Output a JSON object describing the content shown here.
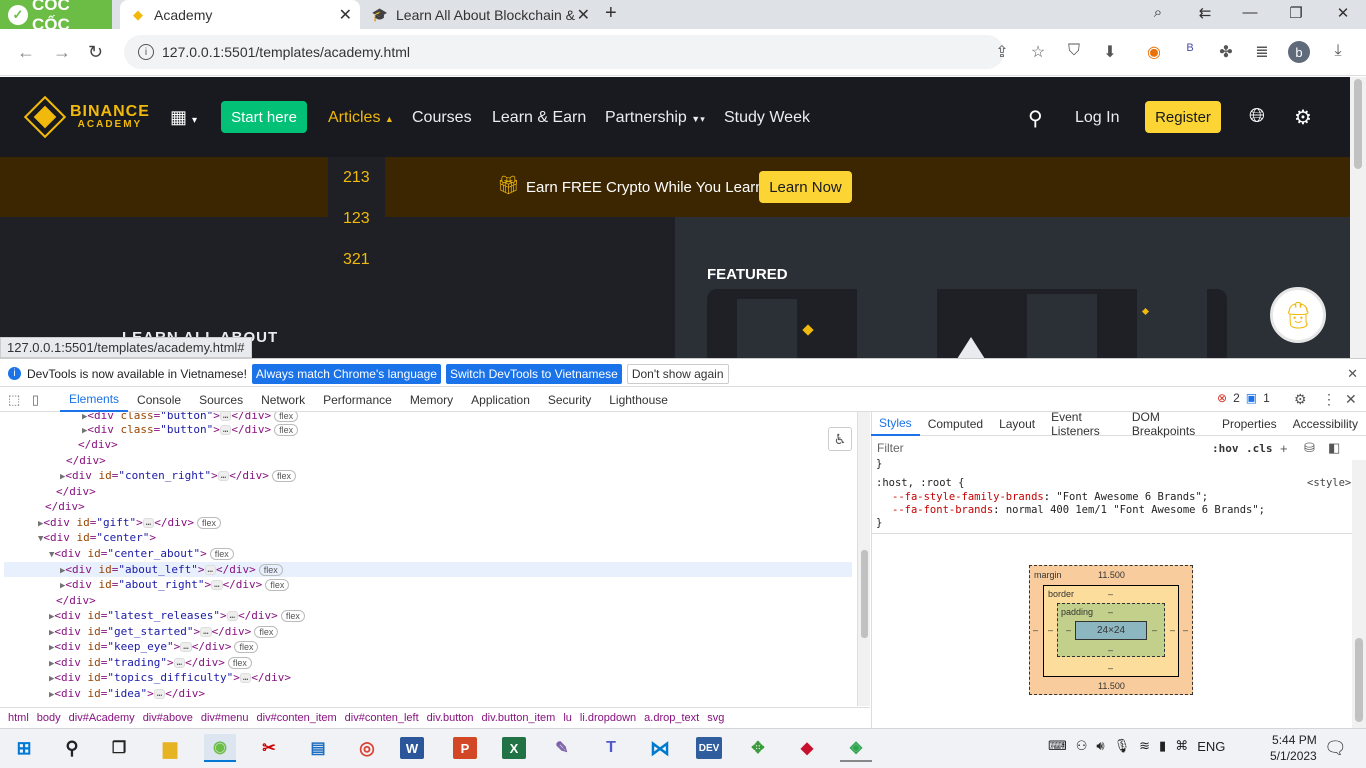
{
  "browser": {
    "logo": "CỐC CỐC",
    "tabs": [
      {
        "title": "Academy",
        "active": true
      },
      {
        "title": "Learn All About Blockchain &",
        "active": false
      }
    ],
    "url": "127.0.0.1:5501/templates/academy.html",
    "status_url": "127.0.0.1:5501/templates/academy.html#",
    "profile_initial": "b"
  },
  "site": {
    "logo_top": "BINANCE",
    "logo_bottom": "ACADEMY",
    "start_button": "Start here",
    "nav": [
      "Articles",
      "Courses",
      "Learn & Earn",
      "Partnership",
      "Study Week"
    ],
    "login": "Log In",
    "register": "Register",
    "dropdown_items": [
      "213",
      "123",
      "321"
    ],
    "banner_text": "Earn FREE Crypto While You Learn",
    "banner_button": "Learn Now",
    "featured_label": "FEATURED",
    "hero_text": "LEARN ALL ABOUT",
    "colors": {
      "accent": "#f0b90b",
      "start_green": "#02c076",
      "banner_bg": "#3c2601",
      "header_bg": "#181a20"
    }
  },
  "devtools": {
    "notice": "DevTools is now available in Vietnamese!",
    "notice_btn1": "Always match Chrome's language",
    "notice_btn2": "Switch DevTools to Vietnamese",
    "notice_btn3": "Don't show again",
    "tabs": [
      "Elements",
      "Console",
      "Sources",
      "Network",
      "Performance",
      "Memory",
      "Application",
      "Security",
      "Lighthouse"
    ],
    "errors": "2",
    "messages": "1",
    "breadcrumbs": [
      "html",
      "body",
      "div#Academy",
      "div#above",
      "div#menu",
      "div#conten_item",
      "div#conten_left",
      "div.button",
      "div.button_item",
      "lu",
      "li.dropdown",
      "a.drop_text",
      "svg"
    ],
    "style_tabs": [
      "Styles",
      "Computed",
      "Layout",
      "Event Listeners",
      "DOM Breakpoints",
      "Properties",
      "Accessibility"
    ],
    "filter_placeholder": "Filter",
    "hov": ":hov",
    "cls": ".cls",
    "rule_selector": ":host, :root {",
    "rule_source": "<style>",
    "rule_close": "}",
    "prop1_name": "--fa-style-family-brands",
    "prop1_value": "\"Font Awesome 6 Brands\";",
    "prop2_name": "--fa-font-brands",
    "prop2_value": "normal 400 1em/1 \"Font Awesome 6 Brands\";",
    "box": {
      "margin_label": "margin",
      "margin_top": "11.500",
      "margin_bottom": "11.500",
      "border_label": "border",
      "padding_label": "padding",
      "content": "24×24",
      "dash": "–"
    }
  },
  "taskbar": {
    "time": "5:44 PM",
    "date": "5/1/2023",
    "language": "ENG"
  }
}
